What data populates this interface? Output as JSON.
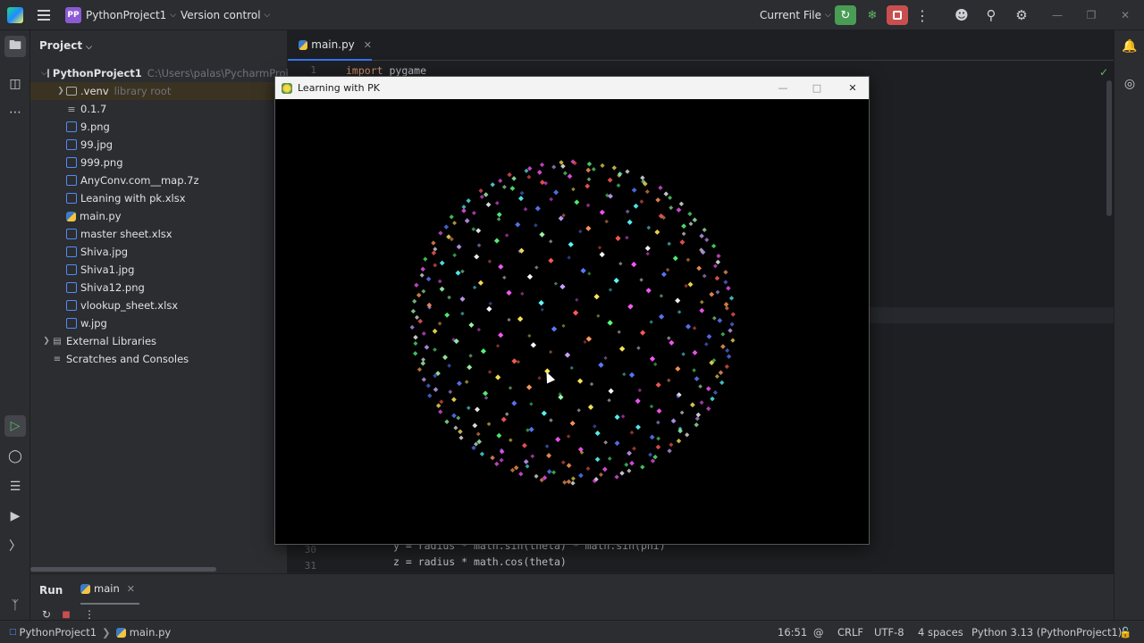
{
  "titlebar": {
    "project_badge": "PP",
    "project_name": "PythonProject1",
    "vcs_label": "Version control",
    "run_config": "Current File"
  },
  "project_panel": {
    "title": "Project",
    "root": {
      "name": "PythonProject1",
      "path": "C:\\Users\\palas\\PycharmProje"
    },
    "items": [
      {
        "name": ".venv",
        "note": "library root",
        "icon": "folder-icon"
      },
      {
        "name": "0.1.7",
        "icon": "text-file-icon"
      },
      {
        "name": "9.png",
        "icon": "image-file-icon"
      },
      {
        "name": "99.jpg",
        "icon": "image-file-icon"
      },
      {
        "name": "999.png",
        "icon": "image-file-icon"
      },
      {
        "name": "AnyConv.com__map.7z",
        "icon": "file-icon"
      },
      {
        "name": "Leaning with pk.xlsx",
        "icon": "file-icon"
      },
      {
        "name": "main.py",
        "icon": "python-file-icon"
      },
      {
        "name": "master sheet.xlsx",
        "icon": "file-icon"
      },
      {
        "name": "Shiva.jpg",
        "icon": "image-file-icon"
      },
      {
        "name": "Shiva1.jpg",
        "icon": "image-file-icon"
      },
      {
        "name": "Shiva12.png",
        "icon": "image-file-icon"
      },
      {
        "name": "vlookup_sheet.xlsx",
        "icon": "file-icon"
      },
      {
        "name": "w.jpg",
        "icon": "image-file-icon"
      }
    ],
    "external_libraries": "External Libraries",
    "scratches": "Scratches and Consoles"
  },
  "editor": {
    "tab_label": "main.py",
    "lines": [
      {
        "num": "1",
        "keyword": "import",
        "text": " pygame"
      },
      {
        "num": "30",
        "keyword": "",
        "text": "y = radius * math.sin(theta) * math.sin(phi)"
      },
      {
        "num": "31",
        "keyword": "",
        "text": "z = radius * math.cos(theta)"
      }
    ]
  },
  "pygame_window": {
    "title": "Learning with PK",
    "dot_colors": [
      "#ffffff",
      "#ff5a5a",
      "#5aff7a",
      "#5a7aff",
      "#ff5aff",
      "#ffe75a",
      "#5affff",
      "#ff9a5a",
      "#c8a0ff",
      "#a0ffb0"
    ]
  },
  "run_panel": {
    "title": "Run",
    "tab_label": "main"
  },
  "statusbar": {
    "breadcrumb_project": "PythonProject1",
    "breadcrumb_file": "main.py",
    "position": "16:51",
    "line_ending": "CRLF",
    "encoding": "UTF-8",
    "indent": "4 spaces",
    "interpreter": "Python 3.13 (PythonProject1)"
  }
}
